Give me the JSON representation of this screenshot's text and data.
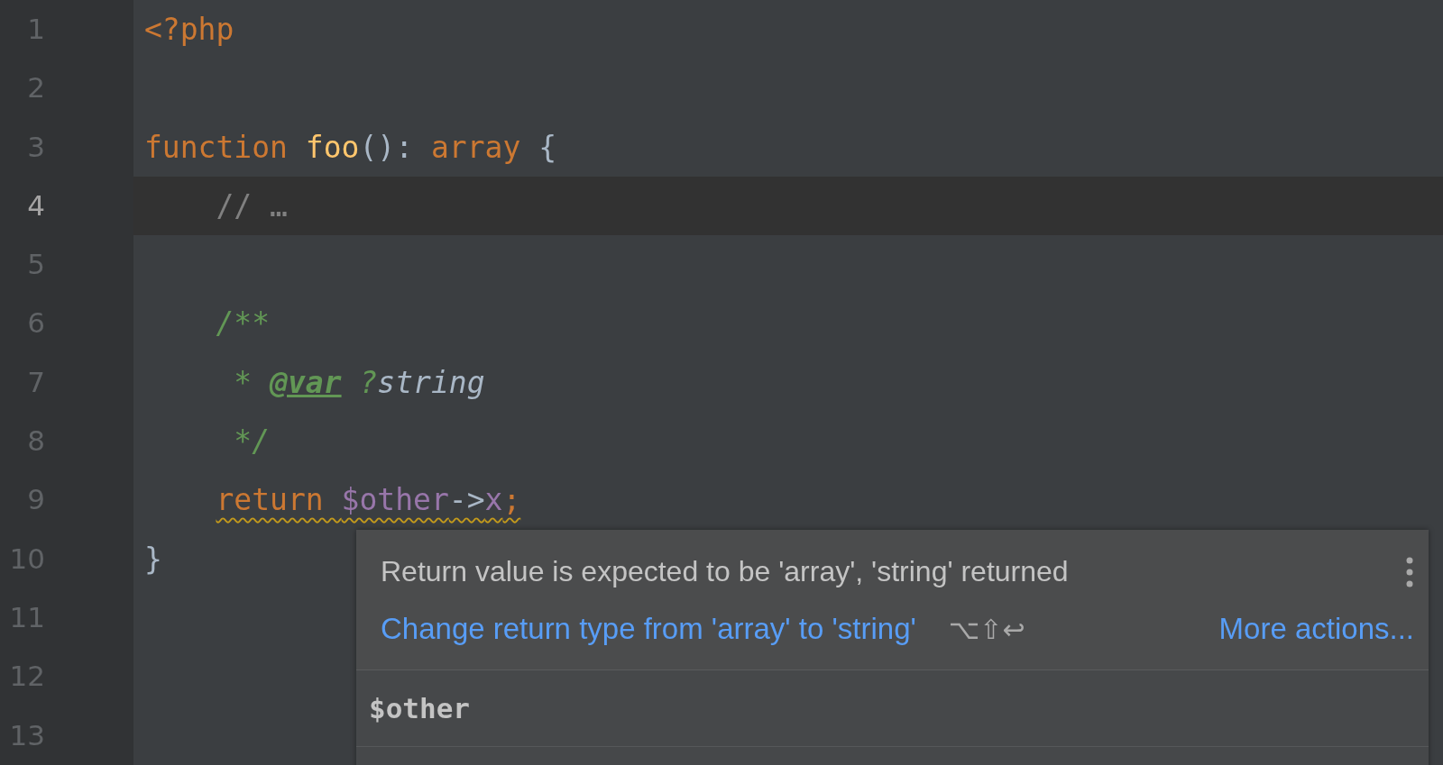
{
  "editor": {
    "lines": [
      {
        "number": "1",
        "current": false,
        "tokens": [
          {
            "kind": "keyword",
            "text": "<?php"
          }
        ]
      },
      {
        "number": "2",
        "current": false
      },
      {
        "number": "3",
        "current": false,
        "tokens": [
          {
            "kind": "keyword",
            "text": "function "
          },
          {
            "kind": "function",
            "text": "foo"
          },
          {
            "kind": "plain",
            "text": "(): "
          },
          {
            "kind": "keyword",
            "text": "array "
          },
          {
            "kind": "plain",
            "text": "{"
          }
        ]
      },
      {
        "number": "4",
        "current": true,
        "tokens": [
          {
            "kind": "comment",
            "text": "    // …"
          }
        ]
      },
      {
        "number": "5",
        "current": false
      },
      {
        "number": "6",
        "current": false,
        "tokens": [
          {
            "kind": "doc",
            "text": "    /**"
          }
        ]
      },
      {
        "number": "7",
        "current": false,
        "tokens": [
          {
            "kind": "doc",
            "text": "     * "
          },
          {
            "kind": "doctag",
            "text": "@var"
          },
          {
            "kind": "doc",
            "text": " ?"
          },
          {
            "kind": "doctype",
            "text": "string"
          }
        ]
      },
      {
        "number": "8",
        "current": false,
        "tokens": [
          {
            "kind": "doc",
            "text": "     */"
          }
        ]
      },
      {
        "number": "9",
        "current": false,
        "warning": true,
        "tokens": [
          {
            "kind": "keyword",
            "text": "    return "
          },
          {
            "kind": "variable",
            "text": "$other"
          },
          {
            "kind": "plain",
            "text": "->"
          },
          {
            "kind": "variable",
            "text": "x"
          },
          {
            "kind": "keyword",
            "text": ";"
          }
        ]
      },
      {
        "number": "10",
        "current": false,
        "tokens": [
          {
            "kind": "plain",
            "text": "}"
          }
        ]
      },
      {
        "number": "11",
        "current": false
      },
      {
        "number": "12",
        "current": false
      },
      {
        "number": "13",
        "current": false
      }
    ]
  },
  "popup": {
    "message": "Return value is expected to be 'array', 'string' returned",
    "action": "Change return type from 'array' to 'string'",
    "shortcut": "⌥⇧↩",
    "more": "More actions...",
    "symbol": "$other"
  }
}
